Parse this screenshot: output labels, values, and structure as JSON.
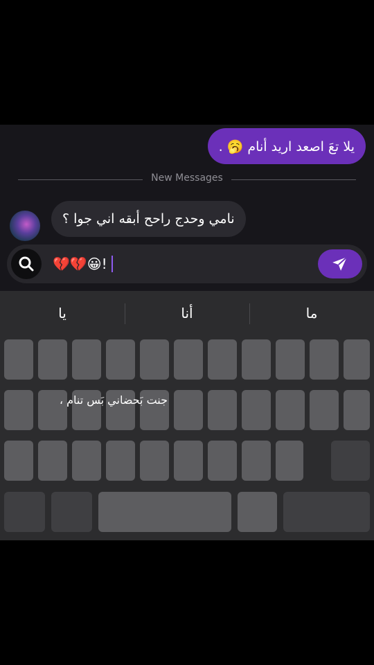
{
  "chat": {
    "my_message": "يلا تعَ اصعد اريد أنام 🥱 .",
    "divider_label": "New Messages",
    "their_message": "نامي وحدج راحح أبقه اني جوا ؟"
  },
  "input": {
    "text": "💔💔😀!"
  },
  "suggestions": [
    "ما",
    "أنا",
    "يا"
  ],
  "overlay_caption": "جنت بَحضاني بَس تنام ،",
  "icons": {
    "search": "search-icon",
    "send": "send-icon"
  },
  "colors": {
    "accent": "#6b30b9",
    "chat_bg": "#17161b",
    "keyboard_bg": "#2c2c2e"
  }
}
